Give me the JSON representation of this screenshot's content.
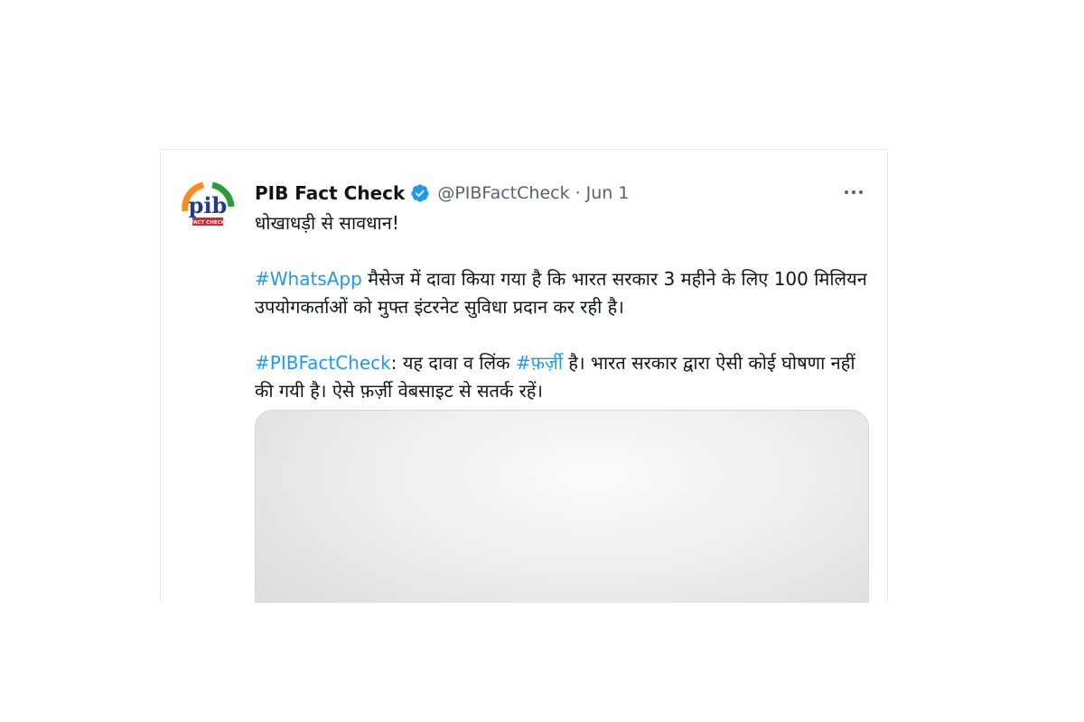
{
  "tweet": {
    "author": {
      "display_name": "PIB Fact Check",
      "handle": "@PIBFactCheck",
      "verified": true,
      "avatar_text": "pib",
      "avatar_subtext": "FACT CHECK"
    },
    "separator": "·",
    "date": "Jun 1",
    "more_icon": "more-horizontal-icon",
    "lines": {
      "headline": "धोखाधड़ी से सावधान!",
      "p1_hashtag": "#WhatsApp",
      "p1_text": " मैसेज में दावा किया गया है कि भारत सरकार 3 महीने के लिए 100 मिलियन उपयोगकर्ताओं को मुफ्त इंटरनेट सुविधा प्रदान कर रही है।",
      "p2_hashtag": "#PIBFactCheck",
      "p2_text_a": ": यह दावा व लिंक ",
      "p2_hashtag_2": "#फ़र्ज़ी",
      "p2_text_b": " है। भारत सरकार द्वारा ऐसी कोई घोषणा नहीं की गयी है। ऐसे फ़र्ज़ी वेबसाइट से सतर्क रहें।"
    }
  },
  "colors": {
    "link": "#1d9bf0",
    "text": "#0f1419",
    "muted": "#536471",
    "verified": "#1d9bf0"
  }
}
